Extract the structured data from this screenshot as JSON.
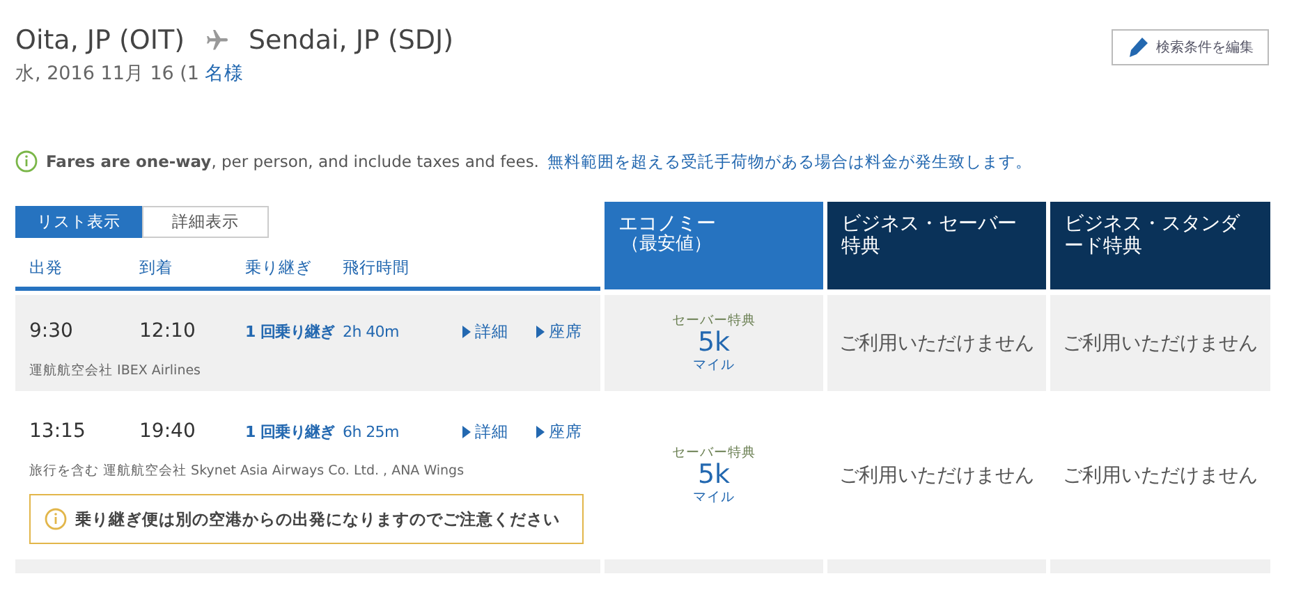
{
  "route": {
    "origin": "Oita, JP (OIT)",
    "destination": "Sendai, JP (SDJ)"
  },
  "subtitle": {
    "date": "水, 2016 11月 16 (1",
    "passengers_link": "名様"
  },
  "edit_button": "検索条件を編集",
  "notice": {
    "text": "**Fares are one-way**, per person, and include taxes and fees.",
    "link": "無料範囲を超える受託手荷物がある場合は料金が発生致します。"
  },
  "view_tabs": [
    {
      "label": "リスト表示",
      "selected": true
    },
    {
      "label": "詳細表示",
      "selected": false
    }
  ],
  "columns": [
    "出発",
    "到着",
    "乗り継ぎ",
    "飛行時間"
  ],
  "fare_headers": [
    {
      "label": "エコノミー",
      "sub": "（最安値）",
      "selected": true
    },
    {
      "label": "ビジネス・セーバー特典",
      "selected": false
    },
    {
      "label": "ビジネス・スタンダード特典",
      "selected": false
    }
  ],
  "flights": [
    {
      "shaded": true,
      "depart": "9:30",
      "arrive": "12:10",
      "connections": "1 回乗り継ぎ",
      "duration": "2h 40m",
      "details": "詳細",
      "seats": "座席",
      "operator": "運航航空会社 IBEX Airlines",
      "fares": [
        {
          "kind": "award",
          "label": "セーバー特典",
          "amount": "5k",
          "unit": "マイル"
        },
        {
          "kind": "unavailable",
          "text": "ご利用いただけません"
        },
        {
          "kind": "unavailable",
          "text": "ご利用いただけません"
        }
      ]
    },
    {
      "shaded": false,
      "depart": "13:15",
      "arrive": "19:40",
      "connections": "1 回乗り継ぎ",
      "duration": "6h 25m",
      "details": "詳細",
      "seats": "座席",
      "operator": "旅行を含む 運航航空会社 Skynet Asia Airways Co. Ltd. , ANA Wings",
      "warning": "乗り継ぎ便は別の空港からの出発になりますのでご注意ください",
      "fares": [
        {
          "kind": "award",
          "label": "セーバー特典",
          "amount": "5k",
          "unit": "マイル"
        },
        {
          "kind": "unavailable",
          "text": "ご利用いただけません"
        },
        {
          "kind": "unavailable",
          "text": "ご利用いただけません"
        }
      ]
    }
  ]
}
